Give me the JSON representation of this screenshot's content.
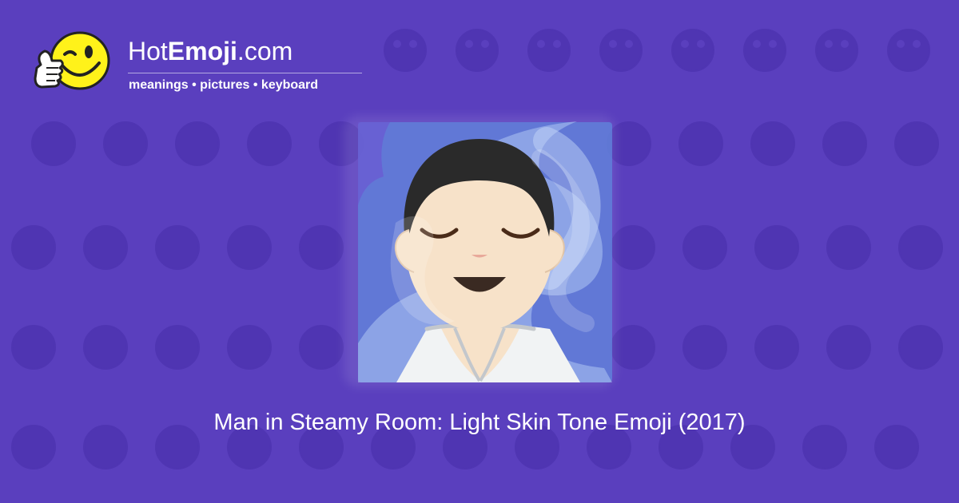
{
  "site": {
    "brand_prefix": "Hot",
    "brand_main": "Emoji",
    "brand_suffix": ".com",
    "tagline": "meanings • pictures • keyboard",
    "logo_icon": "winking-thumbs-up-face-icon"
  },
  "emoji": {
    "title": "Man in Steamy Room: Light Skin Tone Emoji (2017)",
    "icon": "man-in-steamy-room-light-skin-tone-icon"
  },
  "colors": {
    "background": "#5a3fbe",
    "pattern": "#4f35b2",
    "text": "#ffffff",
    "logo_face": "#fff21a",
    "steam_blue": "#5f7fd8",
    "skin": "#f7e2c9",
    "hair": "#2a2a2a",
    "robe": "#f1f3f4"
  }
}
